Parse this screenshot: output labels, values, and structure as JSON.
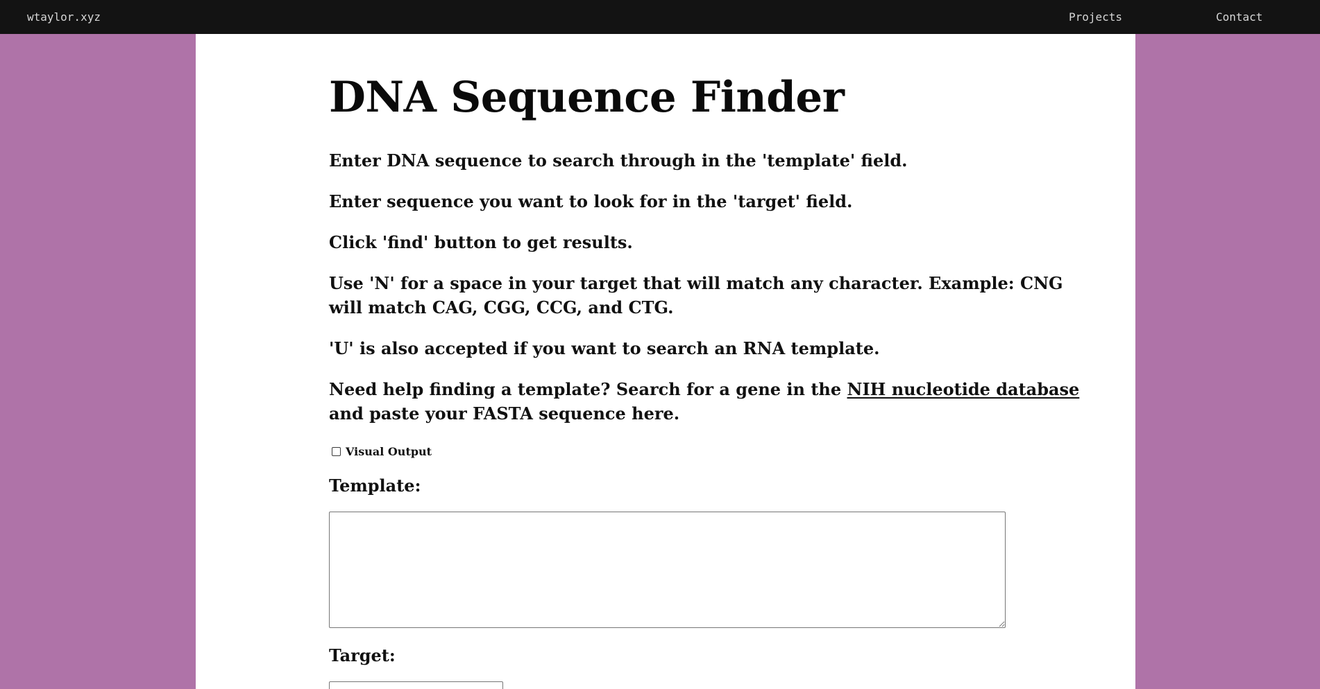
{
  "nav": {
    "brand": "wtaylor.xyz",
    "links": [
      {
        "label": "Projects"
      },
      {
        "label": "Contact"
      }
    ]
  },
  "page": {
    "title": "DNA Sequence Finder",
    "instructions": {
      "p1": "Enter DNA sequence to search through in the 'template' field.",
      "p2": "Enter sequence you want to look for in the 'target' field.",
      "p3": "Click 'find' button to get results.",
      "p4_line1": "Use 'N' for a space in your target that will match any character. Example: CNG",
      "p4_line2": "will match CAG, CGG, CCG, and CTG.",
      "p5": "'U' is also accepted if you want to search an RNA template.",
      "p6_before_link": "Need help finding a template? Search for a gene in the ",
      "p6_link": "NIH nucleotide database",
      "p6_line2": "and paste your FASTA sequence here."
    },
    "visual_output_label": "Visual Output",
    "visual_output_checked": false,
    "template_label": "Template:",
    "template_value": "",
    "target_label": "Target:",
    "target_value": ""
  },
  "colors": {
    "background": "#af73a8",
    "navbar": "#131313",
    "card": "#ffffff",
    "text": "#111111"
  }
}
